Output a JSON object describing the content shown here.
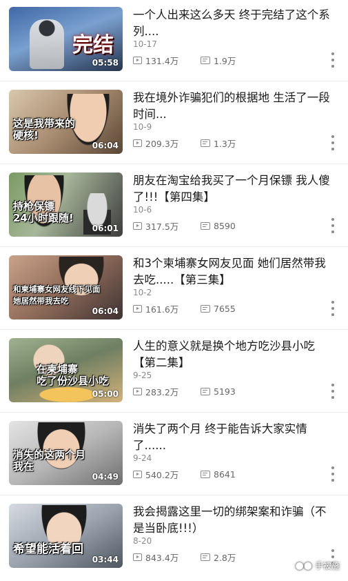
{
  "videos": [
    {
      "title": "一个人出来这么多天 终于完结了这个系列....",
      "date": "10-17",
      "views": "131.4万",
      "comments": "1.9万",
      "duration": "05:58",
      "thumb_text": "完结",
      "thumb_colors": [
        "#3a5a8c",
        "#1d2c44"
      ]
    },
    {
      "title": "我在境外诈骗犯们的根据地 生活了一段时间...",
      "date": "10-9",
      "views": "209.3万",
      "comments": "1.3万",
      "duration": "06:04",
      "thumb_text": "这是我带来的\n     硬核!",
      "thumb_colors": [
        "#c9b79e",
        "#6d5a48"
      ]
    },
    {
      "title": "朋友在淘宝给我买了一个月保镖 我人傻了!!!【第四集】",
      "date": "10-6",
      "views": "317.5万",
      "comments": "8590",
      "duration": "06:01",
      "thumb_text": "持枪保镖\n24小时跟随!",
      "thumb_colors": [
        "#6a8a5a",
        "#3b3b3b"
      ]
    },
    {
      "title": "和3个柬埔寨女网友见面 她们居然带我去吃.....【第三集】",
      "date": "10-2",
      "views": "161.6万",
      "comments": "7655",
      "duration": "06:04",
      "thumb_text": "和柬埔寨女网友线下见面\n  她居然带我去吃",
      "thumb_colors": [
        "#b88a70",
        "#4a3a3a"
      ]
    },
    {
      "title": "人生的意义就是换个地方吃沙县小吃【第二集】",
      "date": "9-25",
      "views": "283.2万",
      "comments": "5193",
      "duration": "05:00",
      "thumb_text": "在柬埔寨\n吃了份沙县小吃",
      "thumb_colors": [
        "#8aa07a",
        "#3e4a36"
      ]
    },
    {
      "title": "消失了两个月 终于能告诉大家实情了......",
      "date": "9-24",
      "views": "540.2万",
      "comments": "8641",
      "duration": "04:49",
      "thumb_text": "消失的这两个月\n        我在",
      "thumb_colors": [
        "#d8d8d8",
        "#7a7a7a"
      ]
    },
    {
      "title": "我会揭露这里一切的绑架案和诈骗（不是当卧底!!!）",
      "date": "8-20",
      "views": "843.4万",
      "comments": "2.8万",
      "duration": "03:44",
      "thumb_text": "希望能活着回",
      "thumb_colors": [
        "#c8ccd4",
        "#5f6670"
      ]
    }
  ],
  "watermark": "手被施"
}
